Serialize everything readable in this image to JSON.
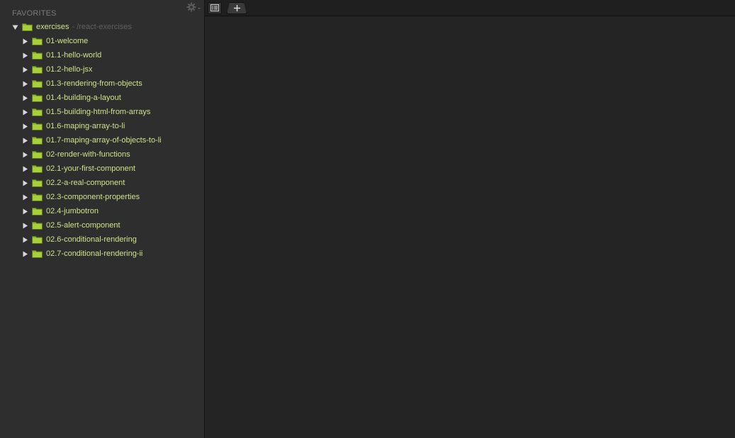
{
  "sidebar": {
    "header": "FAVORITES",
    "root": {
      "label": "exercises",
      "path": "- /react-exercises"
    },
    "folders": [
      "01-welcome",
      "01.1-hello-world",
      "01.2-hello-jsx",
      "01.3-rendering-from-objects",
      "01.4-building-a-layout",
      "01.5-building-html-from-arrays",
      "01.6-maping-array-to-li",
      "01.7-maping-array-of-objects-to-li",
      "02-render-with-functions",
      "02.1-your-first-component",
      "02.2-a-real-component",
      "02.3-component-properties",
      "02.4-jumbotron",
      "02.5-alert-component",
      "02.6-conditional-rendering",
      "02.7-conditional-rendering-ii"
    ]
  },
  "icons": {
    "gear": "gear-icon",
    "expanded": "triangle-down-icon",
    "collapsed": "triangle-right-icon",
    "folder": "folder-icon",
    "tab_list": "tab-list-icon",
    "new_tab": "plus-icon"
  },
  "colors": {
    "sidebar_bg": "#2e2e2e",
    "editor_bg": "#242424",
    "folder_label": "#cde48a",
    "folder_icon": "#8fb82a",
    "header_text": "#7b7b7b"
  }
}
